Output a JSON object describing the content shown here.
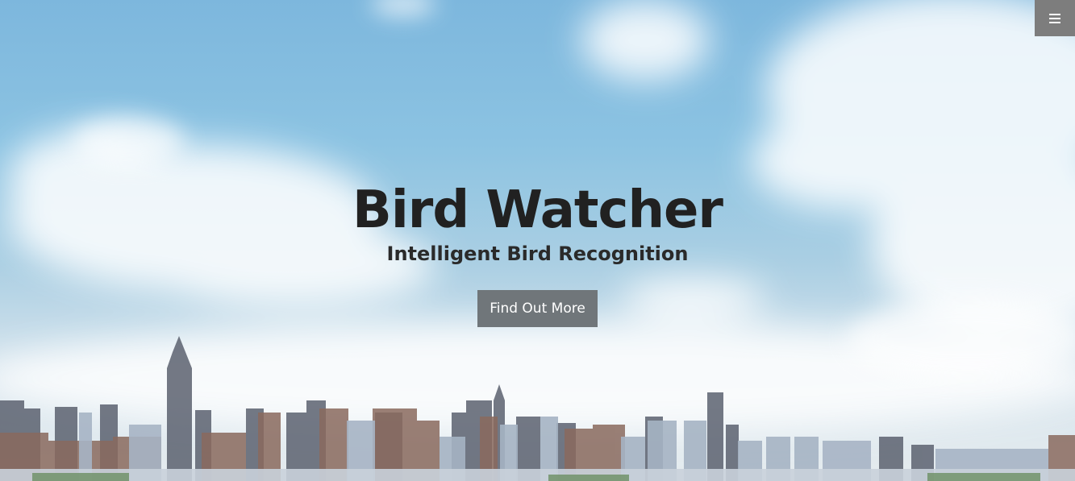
{
  "header": {
    "menu_icon": "hamburger-menu-icon"
  },
  "hero": {
    "title": "Bird Watcher",
    "subtitle": "Intelligent Bird Recognition",
    "cta_label": "Find Out More",
    "background": "city-skyline-sky-photo"
  },
  "colors": {
    "title": "#212121",
    "cta_background": "#70767a",
    "cta_text": "#ffffff",
    "menu_background": "#7d7d7d"
  }
}
